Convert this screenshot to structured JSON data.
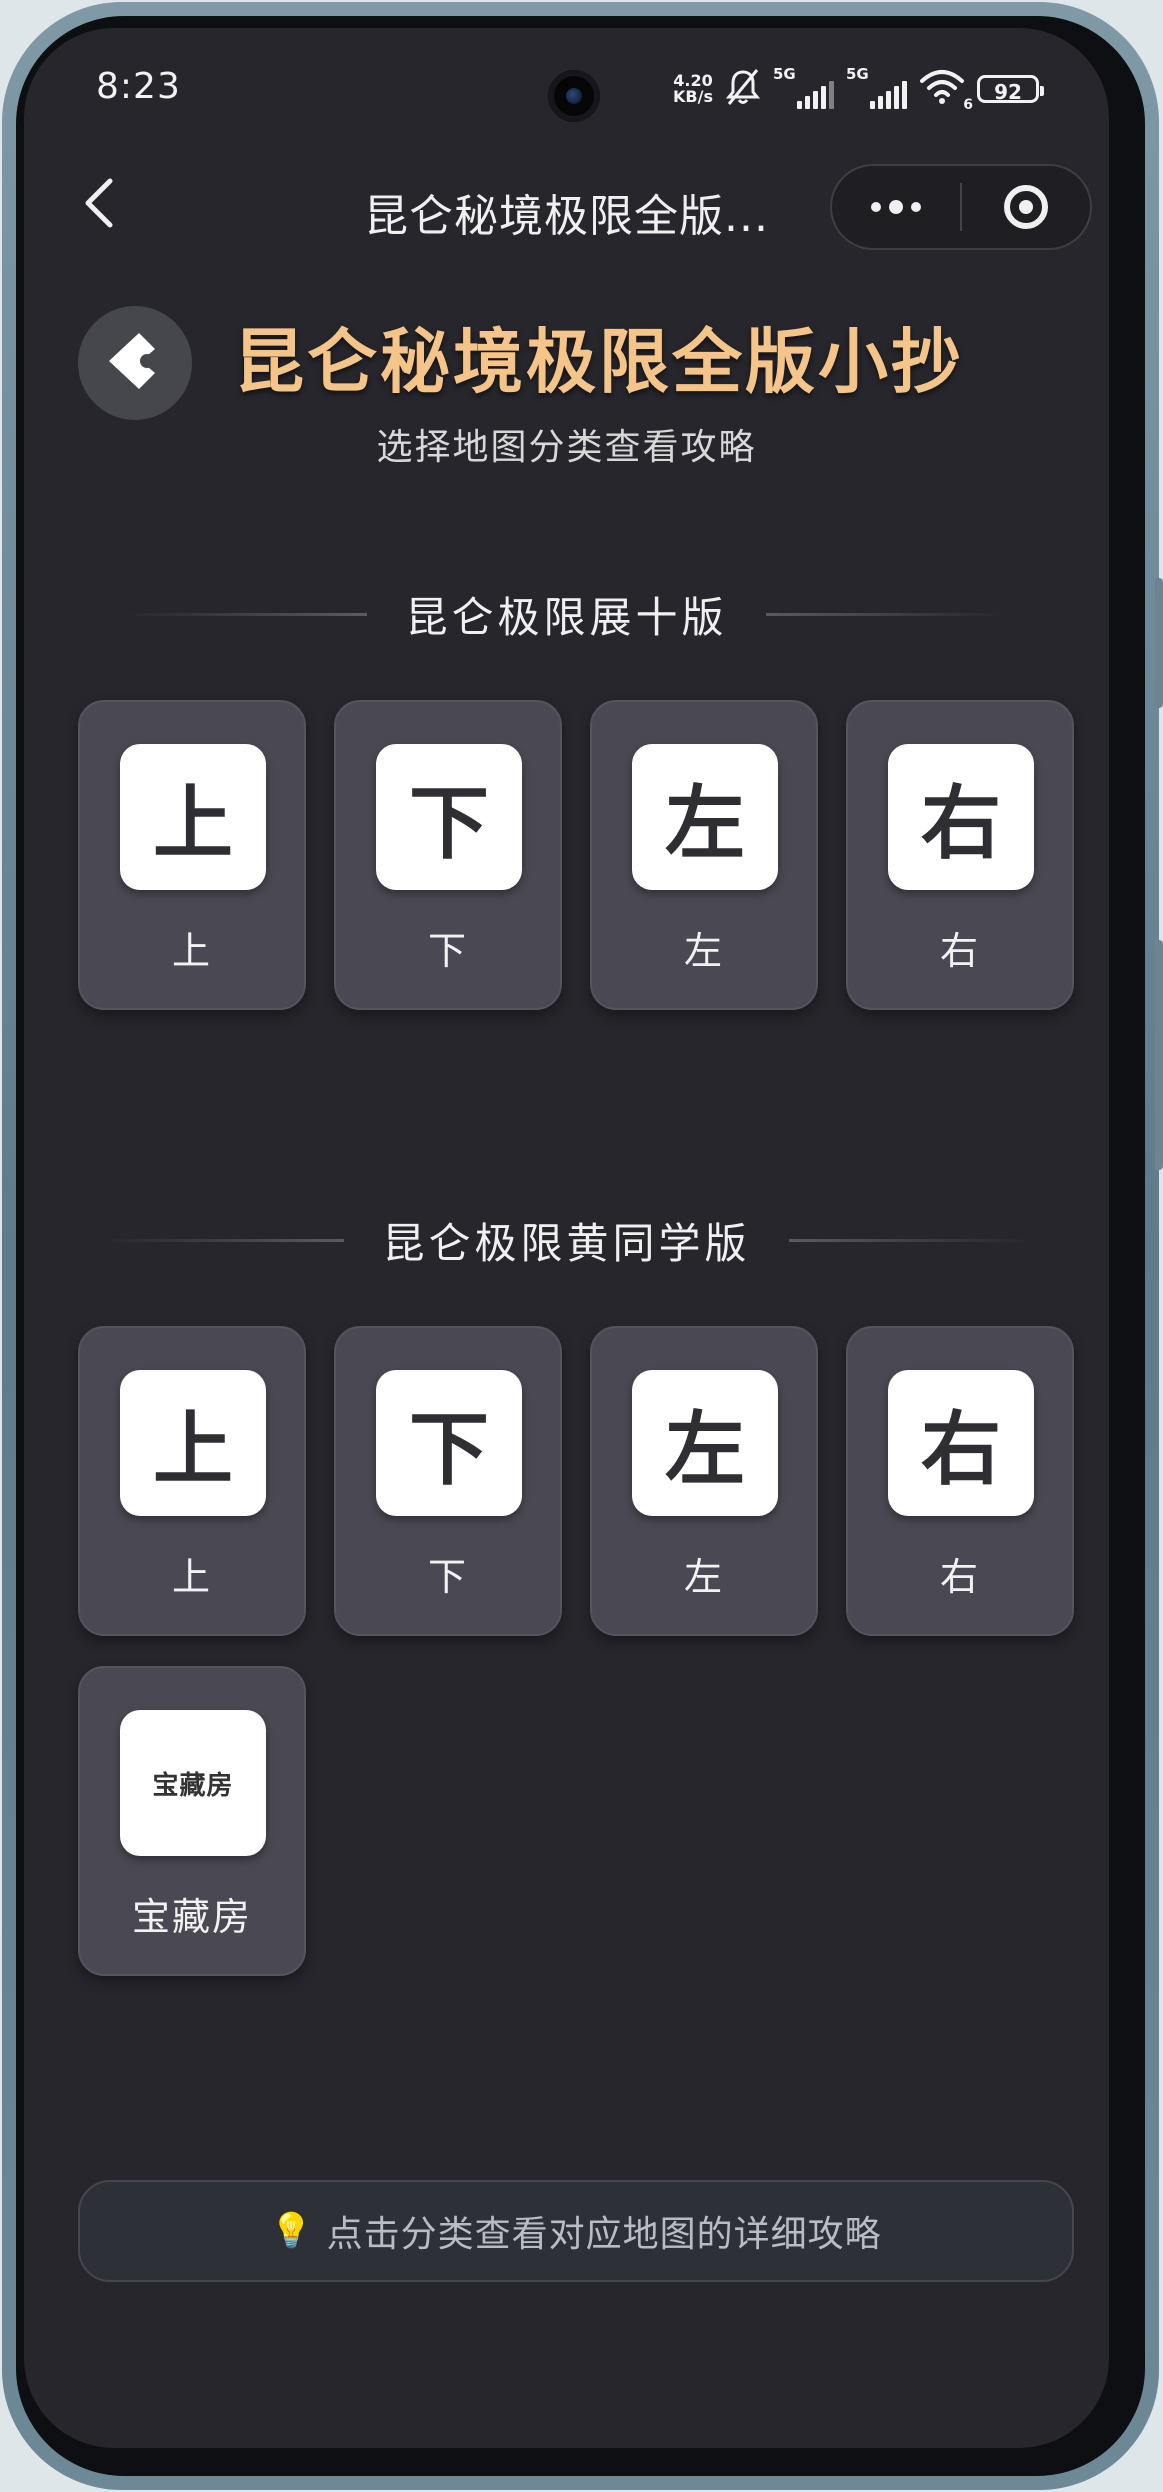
{
  "status_bar": {
    "time": "8:23",
    "network_speed_value": "4.20",
    "network_speed_unit": "KB/s",
    "signal1_label": "5G",
    "signal2_label": "5G",
    "wifi_label": "6",
    "battery": "92"
  },
  "nav": {
    "title": "昆仑秘境极限全版...",
    "more_icon": "more-dots-icon",
    "close_icon": "target-close-icon"
  },
  "header": {
    "title": "昆仑秘境极限全版小抄",
    "subtitle": "选择地图分类查看攻略"
  },
  "sections": [
    {
      "title": "昆仑极限展十版",
      "items": [
        {
          "icon": "上",
          "label": "上"
        },
        {
          "icon": "下",
          "label": "下"
        },
        {
          "icon": "左",
          "label": "左"
        },
        {
          "icon": "右",
          "label": "右"
        }
      ]
    },
    {
      "title": "昆仑极限黄同学版",
      "items": [
        {
          "icon": "上",
          "label": "上"
        },
        {
          "icon": "下",
          "label": "下"
        },
        {
          "icon": "左",
          "label": "左"
        },
        {
          "icon": "右",
          "label": "右"
        },
        {
          "icon": "宝藏房",
          "label": "宝藏房"
        }
      ]
    }
  ],
  "hint": {
    "icon": "💡",
    "text": "点击分类查看对应地图的详细攻略"
  },
  "colors": {
    "background": "#26262c",
    "title_accent": "#f5c488",
    "card": "#4a4852"
  }
}
